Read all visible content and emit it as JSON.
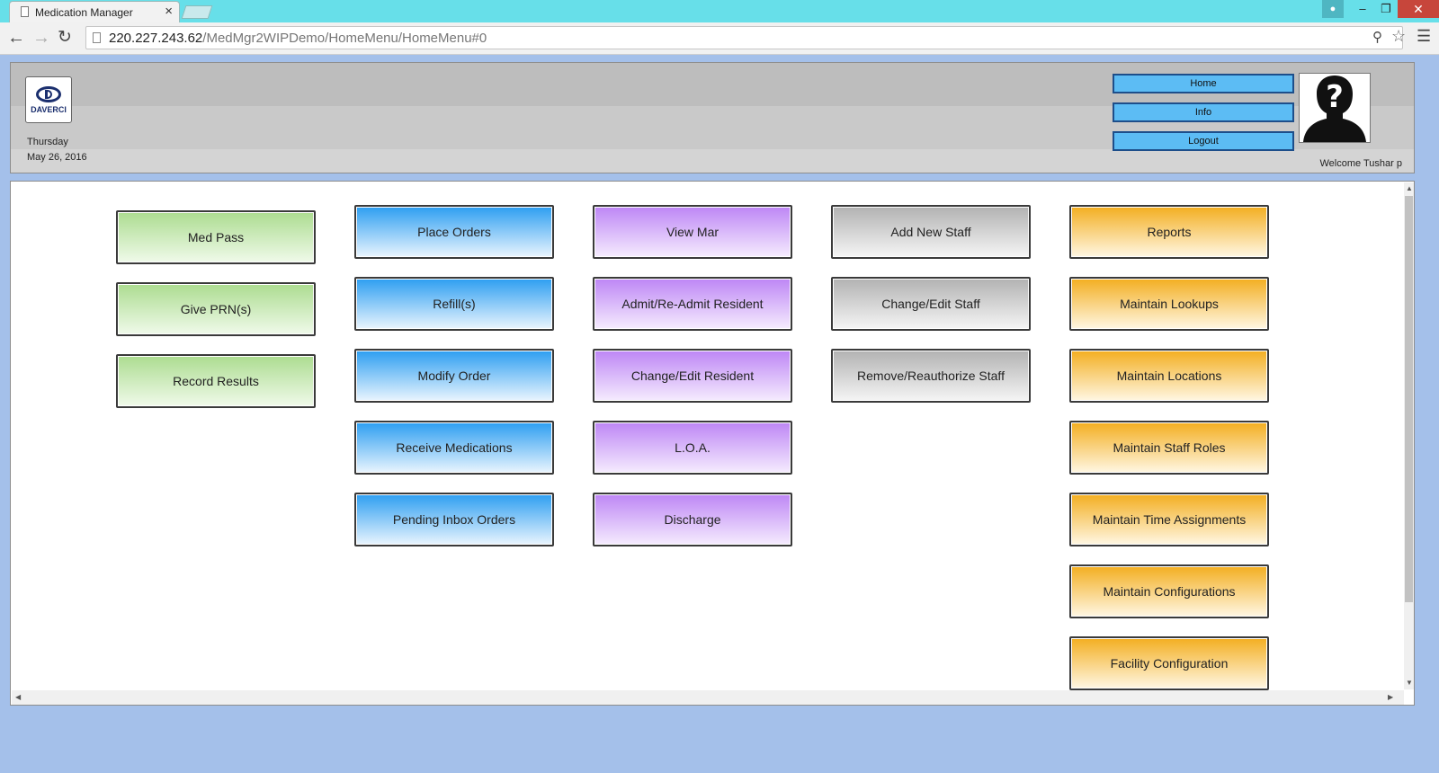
{
  "browser": {
    "tab_title": "Medication Manager",
    "tab_close": "×",
    "url_host": "220.227.243.62",
    "url_path": "/MedMgr2WIPDemo/HomeMenu/HomeMenu#0",
    "icons": {
      "back": "back-arrow-icon",
      "forward": "forward-arrow-icon",
      "reload": "reload-icon",
      "zoom": "zoom-icon",
      "bookmark": "star-icon",
      "menu": "hamburger-menu-icon"
    }
  },
  "header": {
    "logo_text": "DAVERCI",
    "day": "Thursday",
    "date": "May 26, 2016",
    "buttons": {
      "home": "Home",
      "info": "Info",
      "logout": "Logout"
    },
    "welcome": "Welcome Tushar p"
  },
  "menu": {
    "column1": [
      "Med Pass",
      "Give PRN(s)",
      "Record Results"
    ],
    "column2": [
      "Place Orders",
      "Refill(s)",
      "Modify Order",
      "Receive Medications",
      "Pending Inbox Orders"
    ],
    "column3": [
      "View Mar",
      "Admit/Re-Admit Resident",
      "Change/Edit Resident",
      "L.O.A.",
      "Discharge"
    ],
    "column4": [
      "Add New Staff",
      "Change/Edit Staff",
      "Remove/Reauthorize Staff"
    ],
    "column5": [
      "Reports",
      "Maintain Lookups",
      "Maintain Locations",
      "Maintain Staff Roles",
      "Maintain Time Assignments",
      "Maintain Configurations",
      "Facility Configuration"
    ]
  },
  "colors": {
    "column1": "#acdc90",
    "column2": "#2d9ef1",
    "column3": "#bd86f5",
    "column4": "#b2b2b2",
    "column5": "#f3ae20",
    "header_buttons": "#5cbcf4",
    "page_background": "#a4c0ea"
  }
}
